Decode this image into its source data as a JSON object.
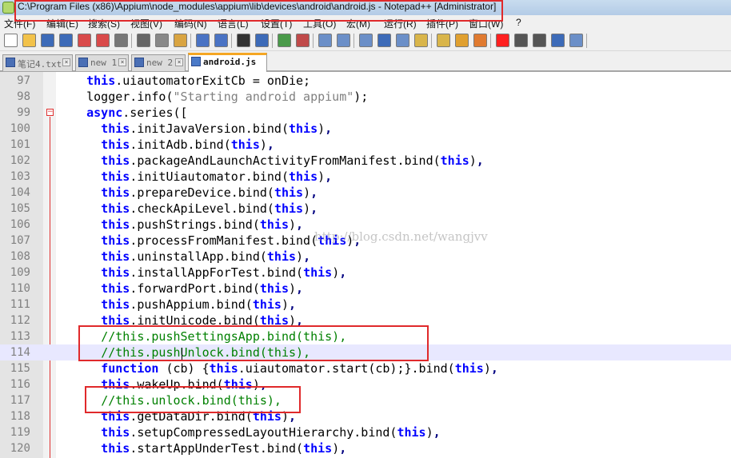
{
  "window": {
    "title": "C:\\Program Files (x86)\\Appium\\node_modules\\appium\\lib\\devices\\android\\android.js - Notepad++ [Administrator]",
    "colors": {
      "annotation": "#e0292b",
      "keyword": "#0000ff",
      "comment": "#008000",
      "string": "#808080"
    }
  },
  "menu": [
    "文件(F)",
    "编辑(E)",
    "搜索(S)",
    "视图(V)",
    "编码(N)",
    "语言(L)",
    "设置(T)",
    "工具(O)",
    "宏(M)",
    "运行(R)",
    "插件(P)",
    "窗口(W)",
    "?"
  ],
  "toolbar": {
    "buttons": [
      "new-file-icon",
      "open-file-icon",
      "save-icon",
      "save-all-icon",
      "close-icon",
      "close-all-icon",
      "print-icon",
      "cut-icon",
      "copy-icon",
      "paste-icon",
      "undo-icon",
      "redo-icon",
      "find-icon",
      "replace-icon",
      "zoom-in-icon",
      "zoom-out-icon",
      "sync-vertical-icon",
      "sync-horizontal-icon",
      "word-wrap-icon",
      "show-all-chars-icon",
      "indent-guide-icon",
      "function-list-icon",
      "document-map-icon",
      "folder-as-workspace-icon",
      "monitor-icon",
      "record-macro-icon",
      "stop-macro-icon",
      "play-macro-icon",
      "run-macro-multiple-icon",
      "save-macro-icon"
    ]
  },
  "tabs": [
    {
      "label": "笔记4.txt",
      "active": false
    },
    {
      "label": "new 1",
      "active": false
    },
    {
      "label": "new 2",
      "active": false
    },
    {
      "label": "android.js",
      "active": true
    }
  ],
  "watermark": "http://blog.csdn.net/wangjvv",
  "lines": [
    {
      "n": "97",
      "tokens": [
        [
          "id",
          "    "
        ],
        [
          "kw",
          "this"
        ],
        [
          "id",
          ".uiautomatorExitCb = onDie;"
        ]
      ]
    },
    {
      "n": "98",
      "tokens": [
        [
          "id",
          "    logger.info("
        ],
        [
          "str",
          "\"Starting android appium\""
        ],
        [
          "id",
          ");"
        ]
      ]
    },
    {
      "n": "99",
      "tokens": [
        [
          "id",
          "    "
        ],
        [
          "kw",
          "async"
        ],
        [
          "id",
          ".series(["
        ]
      ]
    },
    {
      "n": "100",
      "tokens": [
        [
          "id",
          "      "
        ],
        [
          "kw",
          "this"
        ],
        [
          "id",
          ".initJavaVersion.bind("
        ],
        [
          "kw",
          "this"
        ],
        [
          "id",
          ")"
        ],
        [
          "op",
          ","
        ]
      ]
    },
    {
      "n": "101",
      "tokens": [
        [
          "id",
          "      "
        ],
        [
          "kw",
          "this"
        ],
        [
          "id",
          ".initAdb.bind("
        ],
        [
          "kw",
          "this"
        ],
        [
          "id",
          ")"
        ],
        [
          "op",
          ","
        ]
      ]
    },
    {
      "n": "102",
      "tokens": [
        [
          "id",
          "      "
        ],
        [
          "kw",
          "this"
        ],
        [
          "id",
          ".packageAndLaunchActivityFromManifest.bind("
        ],
        [
          "kw",
          "this"
        ],
        [
          "id",
          ")"
        ],
        [
          "op",
          ","
        ]
      ]
    },
    {
      "n": "103",
      "tokens": [
        [
          "id",
          "      "
        ],
        [
          "kw",
          "this"
        ],
        [
          "id",
          ".initUiautomator.bind("
        ],
        [
          "kw",
          "this"
        ],
        [
          "id",
          ")"
        ],
        [
          "op",
          ","
        ]
      ]
    },
    {
      "n": "104",
      "tokens": [
        [
          "id",
          "      "
        ],
        [
          "kw",
          "this"
        ],
        [
          "id",
          ".prepareDevice.bind("
        ],
        [
          "kw",
          "this"
        ],
        [
          "id",
          ")"
        ],
        [
          "op",
          ","
        ]
      ]
    },
    {
      "n": "105",
      "tokens": [
        [
          "id",
          "      "
        ],
        [
          "kw",
          "this"
        ],
        [
          "id",
          ".checkApiLevel.bind("
        ],
        [
          "kw",
          "this"
        ],
        [
          "id",
          ")"
        ],
        [
          "op",
          ","
        ]
      ]
    },
    {
      "n": "106",
      "tokens": [
        [
          "id",
          "      "
        ],
        [
          "kw",
          "this"
        ],
        [
          "id",
          ".pushStrings.bind("
        ],
        [
          "kw",
          "this"
        ],
        [
          "id",
          ")"
        ],
        [
          "op",
          ","
        ]
      ]
    },
    {
      "n": "107",
      "tokens": [
        [
          "id",
          "      "
        ],
        [
          "kw",
          "this"
        ],
        [
          "id",
          ".processFromManifest.bind("
        ],
        [
          "kw",
          "this"
        ],
        [
          "id",
          ")"
        ],
        [
          "op",
          ","
        ]
      ]
    },
    {
      "n": "108",
      "tokens": [
        [
          "id",
          "      "
        ],
        [
          "kw",
          "this"
        ],
        [
          "id",
          ".uninstallApp.bind("
        ],
        [
          "kw",
          "this"
        ],
        [
          "id",
          ")"
        ],
        [
          "op",
          ","
        ]
      ]
    },
    {
      "n": "109",
      "tokens": [
        [
          "id",
          "      "
        ],
        [
          "kw",
          "this"
        ],
        [
          "id",
          ".installAppForTest.bind("
        ],
        [
          "kw",
          "this"
        ],
        [
          "id",
          ")"
        ],
        [
          "op",
          ","
        ]
      ]
    },
    {
      "n": "110",
      "tokens": [
        [
          "id",
          "      "
        ],
        [
          "kw",
          "this"
        ],
        [
          "id",
          ".forwardPort.bind("
        ],
        [
          "kw",
          "this"
        ],
        [
          "id",
          ")"
        ],
        [
          "op",
          ","
        ]
      ]
    },
    {
      "n": "111",
      "tokens": [
        [
          "id",
          "      "
        ],
        [
          "kw",
          "this"
        ],
        [
          "id",
          ".pushAppium.bind("
        ],
        [
          "kw",
          "this"
        ],
        [
          "id",
          ")"
        ],
        [
          "op",
          ","
        ]
      ]
    },
    {
      "n": "112",
      "tokens": [
        [
          "id",
          "      "
        ],
        [
          "kw",
          "this"
        ],
        [
          "id",
          ".initUnicode.bind("
        ],
        [
          "kw",
          "this"
        ],
        [
          "id",
          ")"
        ],
        [
          "op",
          ","
        ]
      ]
    },
    {
      "n": "113",
      "tokens": [
        [
          "id",
          "      "
        ],
        [
          "comment",
          "//this.pushSettingsApp.bind(this),"
        ]
      ]
    },
    {
      "n": "114",
      "tokens": [
        [
          "id",
          "      "
        ],
        [
          "comment",
          "//this.pushUnlock.bind(this),"
        ]
      ],
      "highlight": true
    },
    {
      "n": "115",
      "tokens": [
        [
          "id",
          "      "
        ],
        [
          "kw",
          "function"
        ],
        [
          "id",
          " (cb) {"
        ],
        [
          "kw",
          "this"
        ],
        [
          "id",
          ".uiautomator.start(cb);}.bind("
        ],
        [
          "kw",
          "this"
        ],
        [
          "id",
          ")"
        ],
        [
          "op",
          ","
        ]
      ]
    },
    {
      "n": "116",
      "tokens": [
        [
          "id",
          "      "
        ],
        [
          "kw",
          "this"
        ],
        [
          "id",
          ".wakeUp.bind("
        ],
        [
          "kw",
          "this"
        ],
        [
          "id",
          ")"
        ],
        [
          "op",
          ","
        ]
      ]
    },
    {
      "n": "117",
      "tokens": [
        [
          "id",
          "      "
        ],
        [
          "comment",
          "//this.unlock.bind(this),"
        ]
      ]
    },
    {
      "n": "118",
      "tokens": [
        [
          "id",
          "      "
        ],
        [
          "kw",
          "this"
        ],
        [
          "id",
          ".getDataDir.bind("
        ],
        [
          "kw",
          "this"
        ],
        [
          "id",
          ")"
        ],
        [
          "op",
          ","
        ]
      ]
    },
    {
      "n": "119",
      "tokens": [
        [
          "id",
          "      "
        ],
        [
          "kw",
          "this"
        ],
        [
          "id",
          ".setupCompressedLayoutHierarchy.bind("
        ],
        [
          "kw",
          "this"
        ],
        [
          "id",
          ")"
        ],
        [
          "op",
          ","
        ]
      ]
    },
    {
      "n": "120",
      "tokens": [
        [
          "id",
          "      "
        ],
        [
          "kw",
          "this"
        ],
        [
          "id",
          ".startAppUnderTest.bind("
        ],
        [
          "kw",
          "this"
        ],
        [
          "id",
          ")"
        ],
        [
          "op",
          ","
        ]
      ]
    }
  ]
}
